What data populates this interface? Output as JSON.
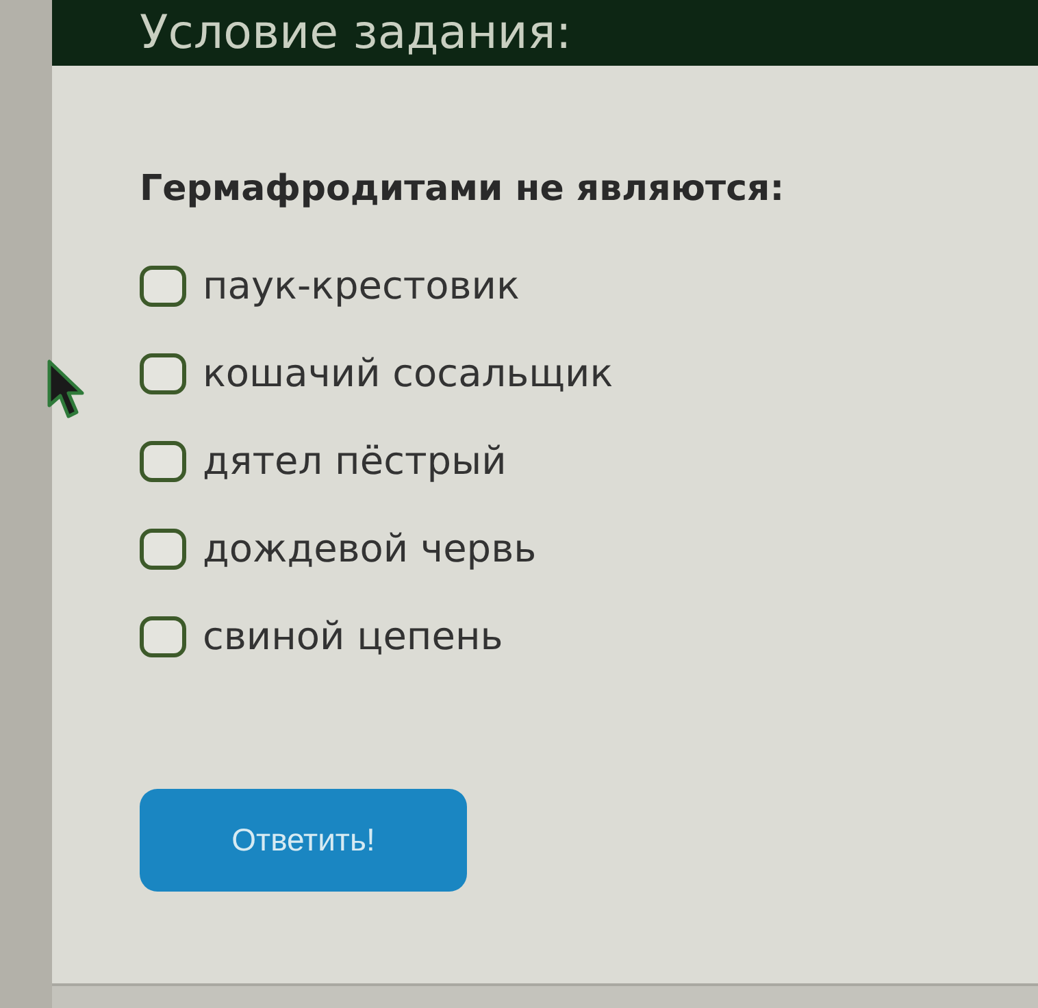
{
  "header": {
    "title": "Условие задания:"
  },
  "question": {
    "text": "Гермафродитами не являются:",
    "options": [
      {
        "label": "паук-крестовик",
        "checked": false
      },
      {
        "label": "кошачий сосальщик",
        "checked": false
      },
      {
        "label": "дятел пёстрый",
        "checked": false
      },
      {
        "label": "дождевой червь",
        "checked": false
      },
      {
        "label": "свиной цепень",
        "checked": false
      }
    ]
  },
  "submit_button": {
    "label": "Ответить!"
  }
}
